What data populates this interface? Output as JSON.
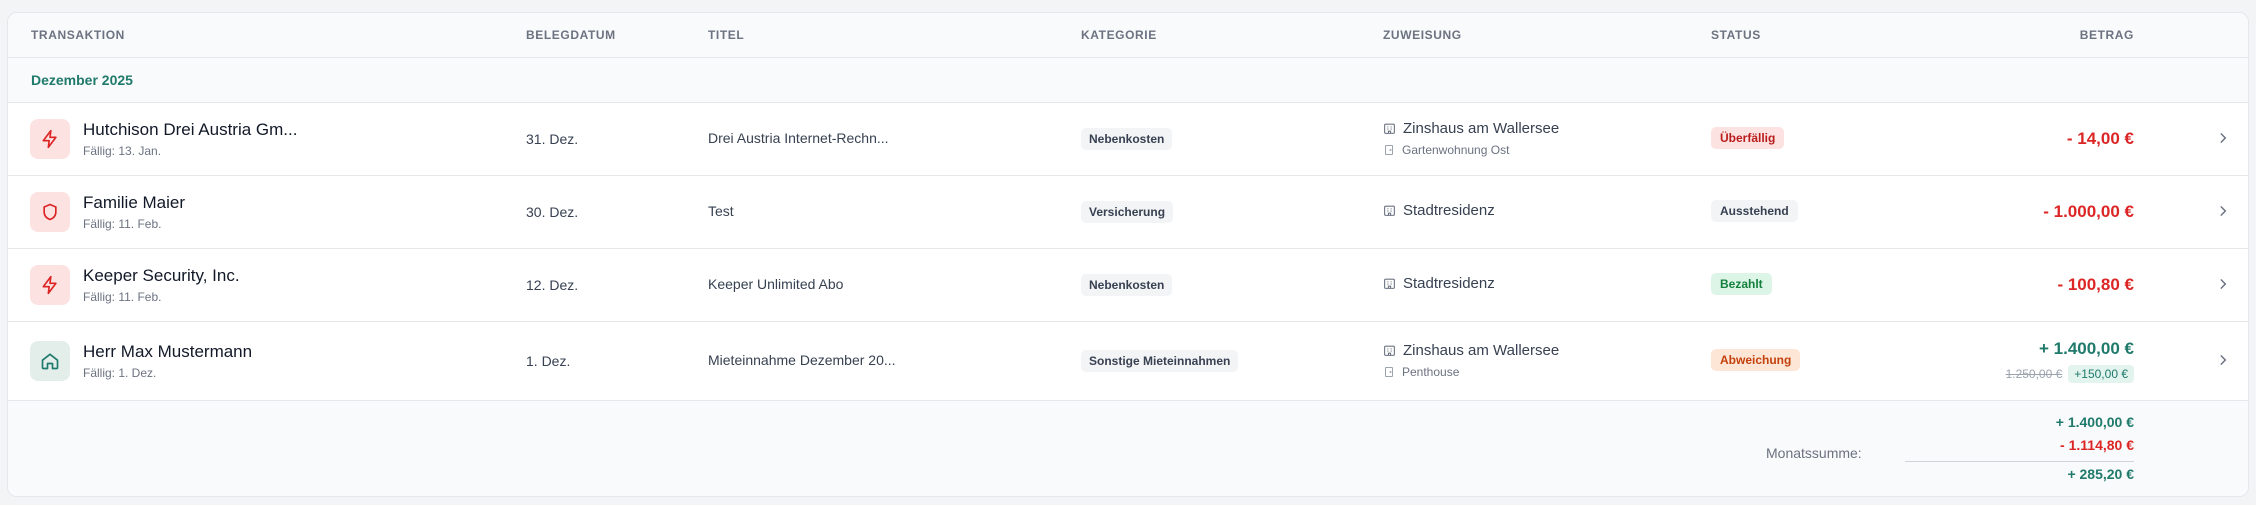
{
  "table": {
    "headers": {
      "transaktion": "TRANSAKTION",
      "belegdatum": "BELEGDATUM",
      "titel": "TITEL",
      "kategorie": "KATEGORIE",
      "zuweisung": "ZUWEISUNG",
      "status": "STATUS",
      "betrag": "BETRAG"
    },
    "group_label": "Dezember 2025",
    "rows": [
      {
        "icon": "bolt-icon",
        "name": "Hutchison Drei Austria Gm...",
        "due": "Fällig: 13. Jan.",
        "date": "31. Dez.",
        "title": "Drei Austria Internet-Rechn...",
        "category": "Nebenkosten",
        "assign_main": "Zinshaus am Wallersee",
        "assign_sub": "Gartenwohnung Ost",
        "status": "Überfällig",
        "amount": "- 14,00 €"
      },
      {
        "icon": "shield-icon",
        "name": "Familie Maier",
        "due": "Fällig: 11. Feb.",
        "date": "30. Dez.",
        "title": "Test",
        "category": "Versicherung",
        "assign_main": "Stadtresidenz",
        "status": "Ausstehend",
        "amount": "- 1.000,00 €"
      },
      {
        "icon": "bolt-icon",
        "name": "Keeper Security, Inc.",
        "due": "Fällig: 11. Feb.",
        "date": "12. Dez.",
        "title": "Keeper Unlimited Abo",
        "category": "Nebenkosten",
        "assign_main": "Stadtresidenz",
        "status": "Bezahlt",
        "amount": "- 100,80 €"
      },
      {
        "icon": "home-icon",
        "name": "Herr Max Mustermann",
        "due": "Fällig: 1. Dez.",
        "date": "1. Dez.",
        "title": "Mieteinnahme Dezember 20...",
        "category": "Sonstige Mieteinnahmen",
        "assign_main": "Zinshaus am Wallersee",
        "assign_sub": "Penthouse",
        "status": "Abweichung",
        "amount": "+ 1.400,00 €",
        "original_amount": "1.250,00 €",
        "difference": "+150,00 €"
      }
    ],
    "summary": {
      "label": "Monatssumme:",
      "income": "+ 1.400,00 €",
      "expenses": "- 1.114,80 €",
      "total": "+ 285,20 €"
    }
  },
  "colors": {
    "accent_green": "#1f7a6b",
    "negative_red": "#dc2626",
    "overdue_bg": "#fde2e2",
    "paid_bg": "#dcf5e7",
    "deviation_bg": "#fde6d6"
  }
}
